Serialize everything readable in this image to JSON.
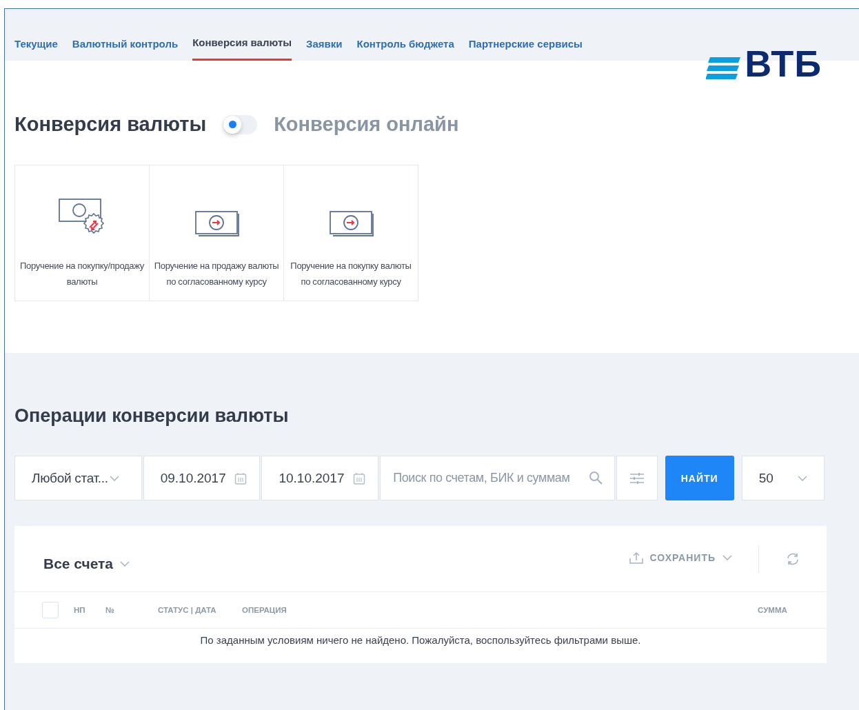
{
  "tabs": [
    {
      "label": "Текущие",
      "selected": false
    },
    {
      "label": "Валютный контроль",
      "selected": false
    },
    {
      "label": "Конверсия валюты",
      "selected": true
    },
    {
      "label": "Заявки",
      "selected": false
    },
    {
      "label": "Контроль бюджета",
      "selected": false
    },
    {
      "label": "Партнерские сервисы",
      "selected": false
    }
  ],
  "logo": {
    "text": "ВТБ"
  },
  "heading": {
    "title": "Конверсия валюты",
    "toggle": {
      "on": false
    },
    "alt_title": "Конверсия онлайн"
  },
  "tiles": [
    {
      "kind": "exchange",
      "label": "Поручение на покупку/продажу валюты"
    },
    {
      "kind": "banknote",
      "label": "Поручение на продажу валюты по согласованному курсу"
    },
    {
      "kind": "banknote",
      "label": "Поручение на покупку валюты по согласованному курсу"
    }
  ],
  "operations": {
    "title": "Операции конверсии валюты",
    "filters": {
      "status": "Любой стат...",
      "date_from": "09.10.2017",
      "date_to": "10.10.2017",
      "search": {
        "placeholder": "Поиск по счетам, БИК и суммам"
      },
      "find_button": "НАЙТИ",
      "page_size": "50"
    },
    "table": {
      "account_selector": "Все счета",
      "save_button": "СОХРАНИТЬ",
      "select_all": {
        "checked": false
      },
      "columns": [
        "НП",
        "№",
        "СТАТУС | ДАТА",
        "ОПЕРАЦИЯ",
        "СУММА"
      ],
      "empty_message": "По заданным условиям ничего не найдено. Пожалуйста, воспользуйтесь фильтрами выше."
    }
  }
}
